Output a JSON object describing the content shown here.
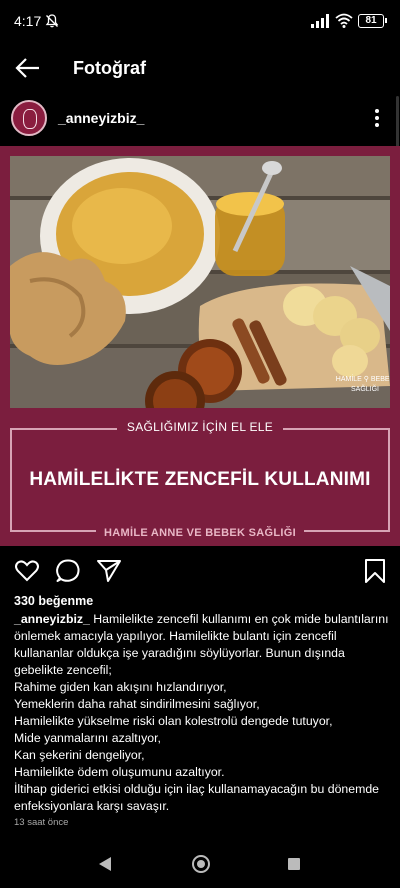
{
  "status_bar": {
    "time": "4:17",
    "battery": "81"
  },
  "app_bar": {
    "title": "Fotoğraf"
  },
  "post": {
    "username": "_anneyizbiz_",
    "image": {
      "watermark_line1": "HAMİLE ⚲ BEBEK",
      "watermark_line2": "SAĞLIĞI",
      "tagline": "SAĞLIĞIMIZ İÇİN EL ELE",
      "title": "HAMİLELİKTE ZENCEFİL KULLANIMI",
      "footer": "HAMİLE ANNE VE BEBEK SAĞLIĞI"
    },
    "likes": "330 beğenme",
    "caption_user": "_anneyizbiz_",
    "caption_first": "Hamilelikte zencefil kullanımı en çok mide bulantılarını önlemek amacıyla yapılıyor. Hamilelikte bulantı için zencefil kullananlar oldukça işe yaradığını söylüyorlar. Bunun dışında gebelikte zencefil;",
    "caption_lines": [
      "Rahime giden kan akışını hızlandırıyor,",
      "Yemeklerin daha rahat sindirilmesini sağlıyor,",
      "Hamilelikte yükselme riski olan kolestrolü dengede tutuyor,",
      "Mide yanmalarını azaltıyor,",
      "Kan şekerini dengeliyor,",
      "Hamilelikte ödem oluşumunu azaltıyor.",
      "İltihap giderici etkisi olduğu için ilaç kullanamayacağın bu dönemde enfeksiyonlara karşı savaşır."
    ],
    "time_ago": "13 saat önce"
  },
  "colors": {
    "brand": "#7b1e3e",
    "accent": "#e9b7c6",
    "background": "#000000"
  },
  "icons": [
    "back-arrow-icon",
    "more-vertical-icon",
    "heart-icon",
    "comment-icon",
    "share-icon",
    "bookmark-icon",
    "nav-back-icon",
    "nav-home-icon",
    "nav-recents-icon"
  ]
}
